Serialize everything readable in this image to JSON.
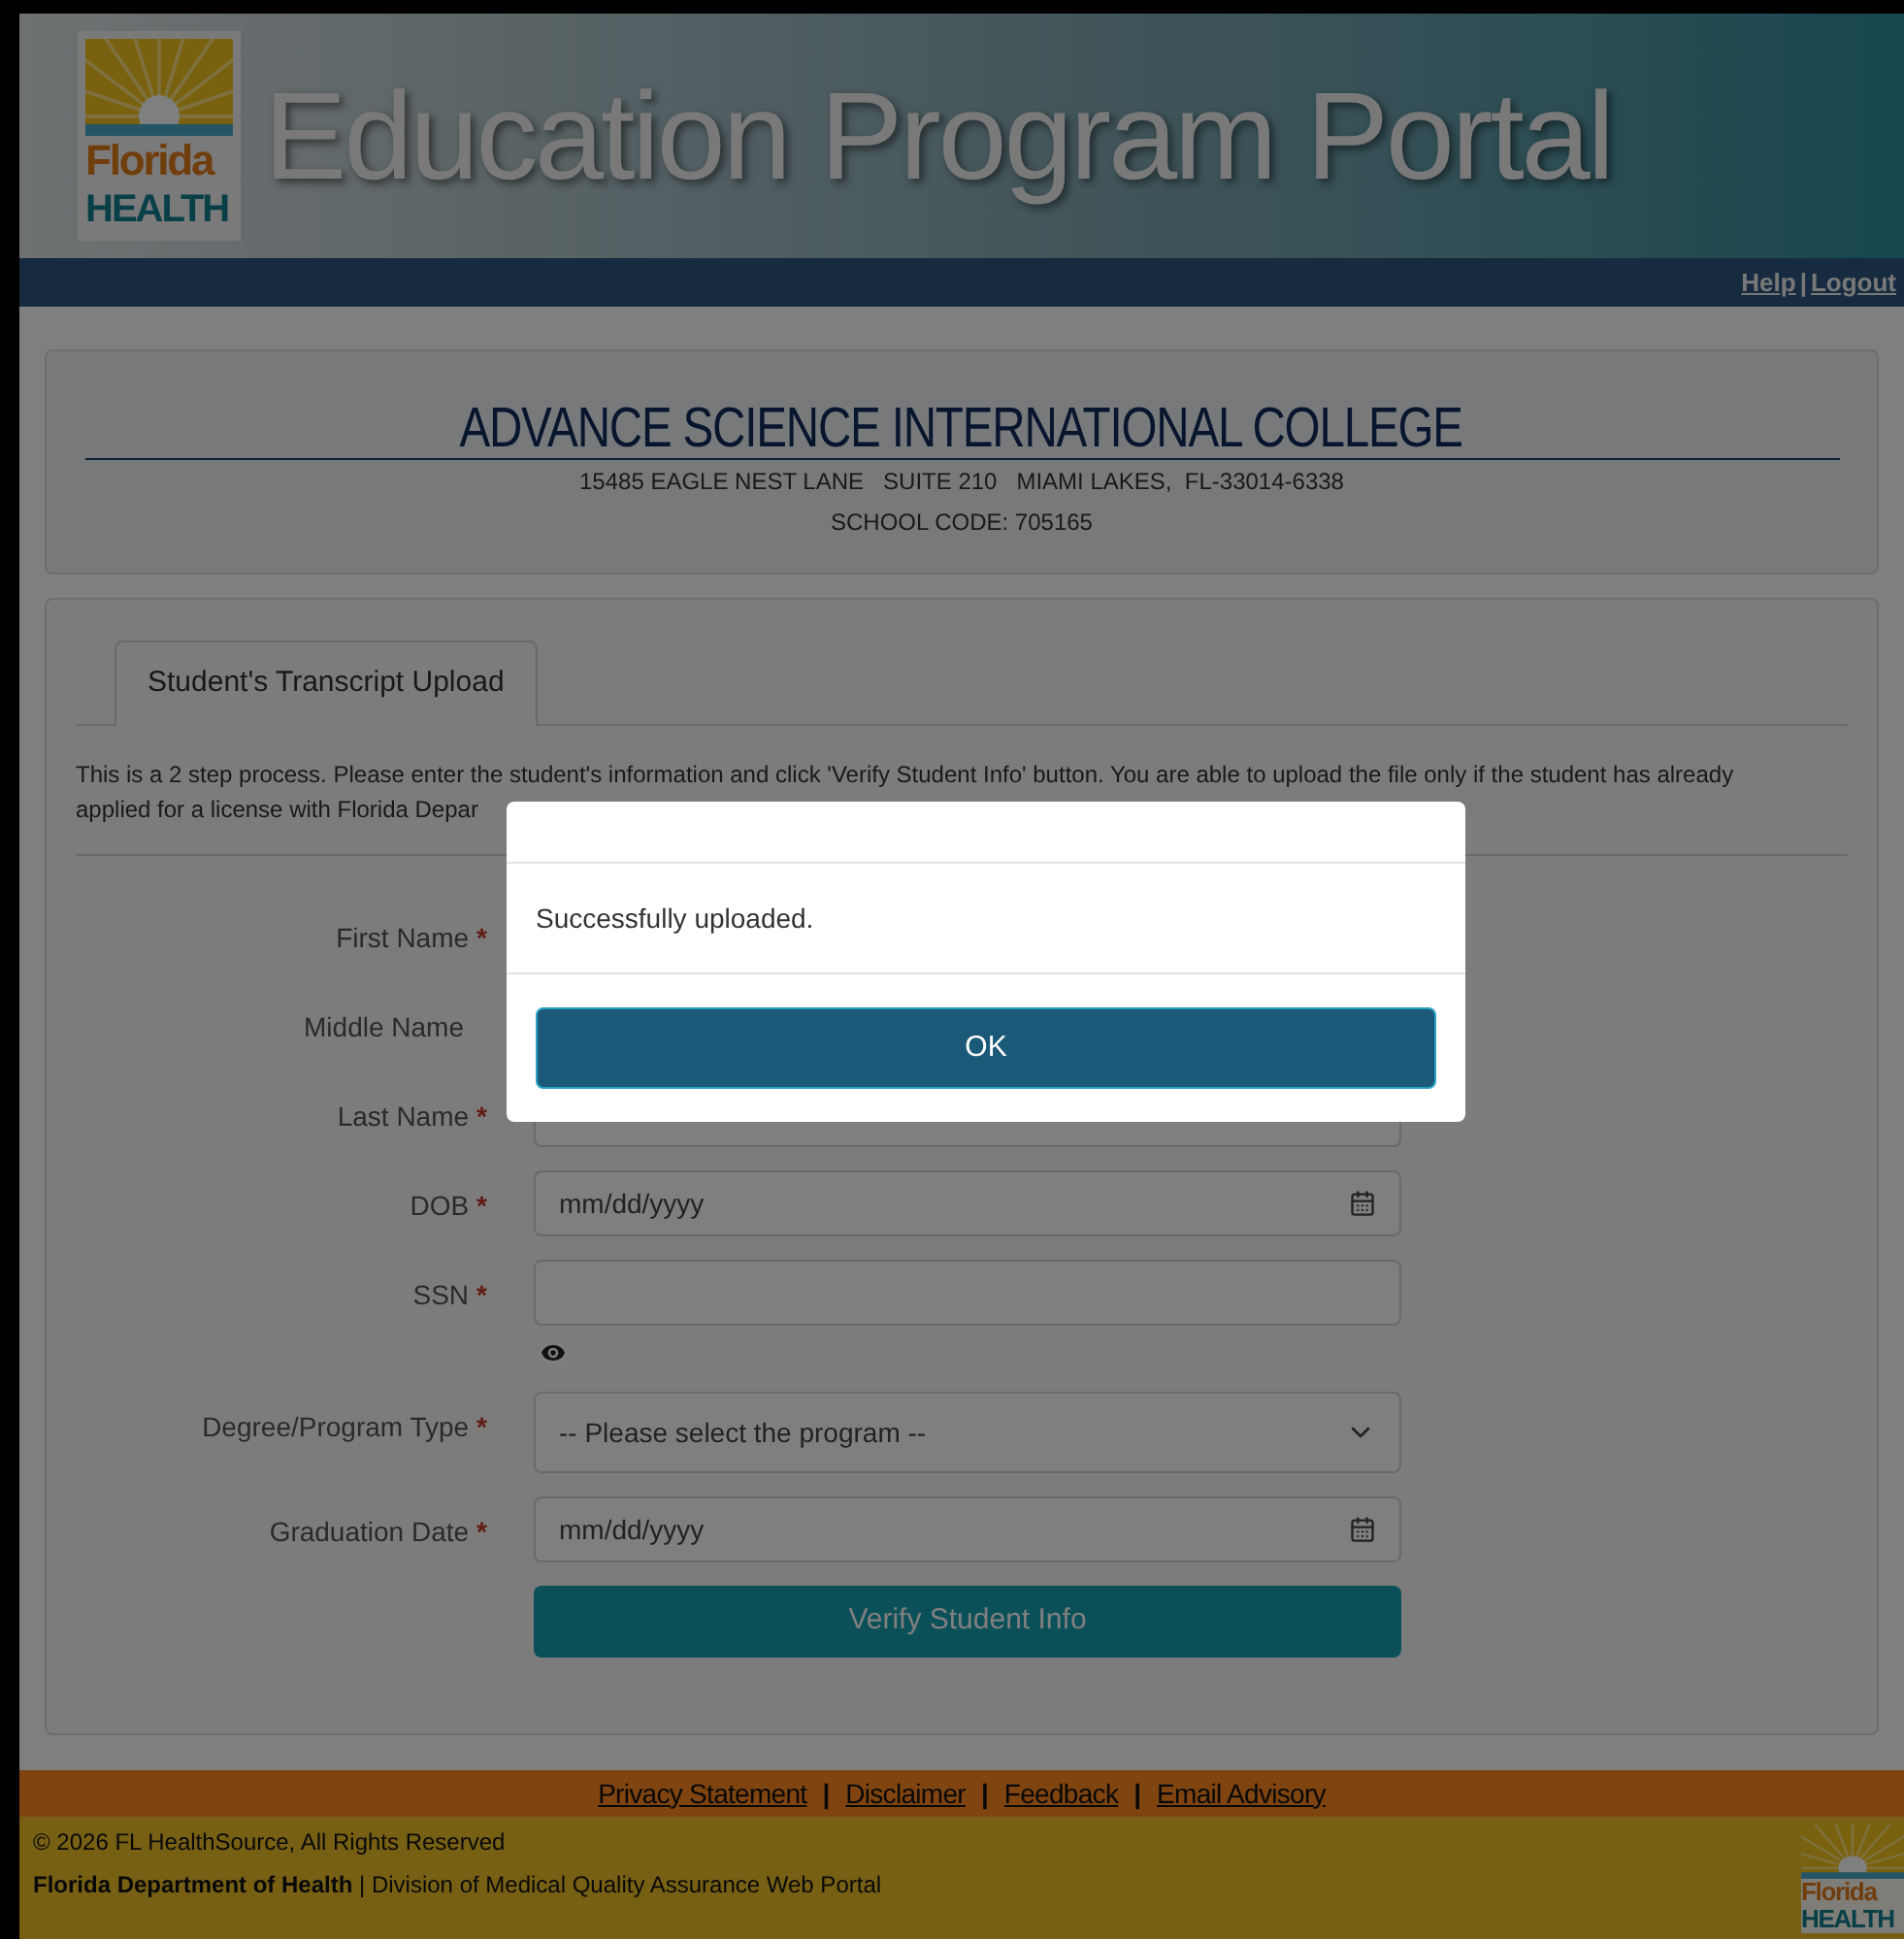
{
  "header": {
    "logo": {
      "line1": "Florida",
      "line2": "HEALTH"
    },
    "title": "Education Program Portal"
  },
  "navbar": {
    "links": [
      "Help",
      "Logout"
    ],
    "separator": "|"
  },
  "school": {
    "name": "ADVANCE SCIENCE INTERNATIONAL COLLEGE",
    "address": "15485 EAGLE NEST LANE   SUITE 210   MIAMI LAKES,  FL-33014-6338",
    "code": "SCHOOL CODE: 705165"
  },
  "tabs": [
    {
      "label": "Student's Transcript Upload",
      "selected": true
    }
  ],
  "instructions": [
    "This is a 2 step process. Please enter the student's information and click 'Verify Student Info' button. You are able to upload the file only if the student has already",
    "applied for a license with Florida Depar"
  ],
  "form": {
    "fields": [
      {
        "label": "First Name",
        "required_mark": "*"
      },
      {
        "label": "Middle Name"
      },
      {
        "label": "Last Name",
        "required_mark": "*",
        "kind": "text"
      },
      {
        "label": "DOB",
        "required_mark": "*",
        "kind": "date",
        "placeholder": "mm/dd/yyyy"
      },
      {
        "label": "SSN",
        "required_mark": "*",
        "kind": "secret",
        "reveal_toggle": true
      },
      {
        "label": "Degree/Program Type",
        "required_mark": "*",
        "kind": "select",
        "value": "-- Please select the program --"
      },
      {
        "label": "Graduation Date",
        "required_mark": "*",
        "kind": "date",
        "placeholder": "mm/dd/yyyy"
      }
    ],
    "submit": {
      "label": "Verify Student Info"
    }
  },
  "footer": {
    "links": [
      "Privacy Statement",
      "Disclaimer",
      "Feedback",
      "Email Advisory"
    ],
    "separator": "|",
    "copyright": "© 2026 FL HealthSource, All Rights Reserved",
    "portal": "**Florida Department of Health** | Division of Medical Quality Assurance Web Portal",
    "logo": {
      "line1": "Florida",
      "line2": "HEALTH"
    }
  },
  "dialog": {
    "message": "Successfully uploaded.",
    "button": "OK"
  }
}
